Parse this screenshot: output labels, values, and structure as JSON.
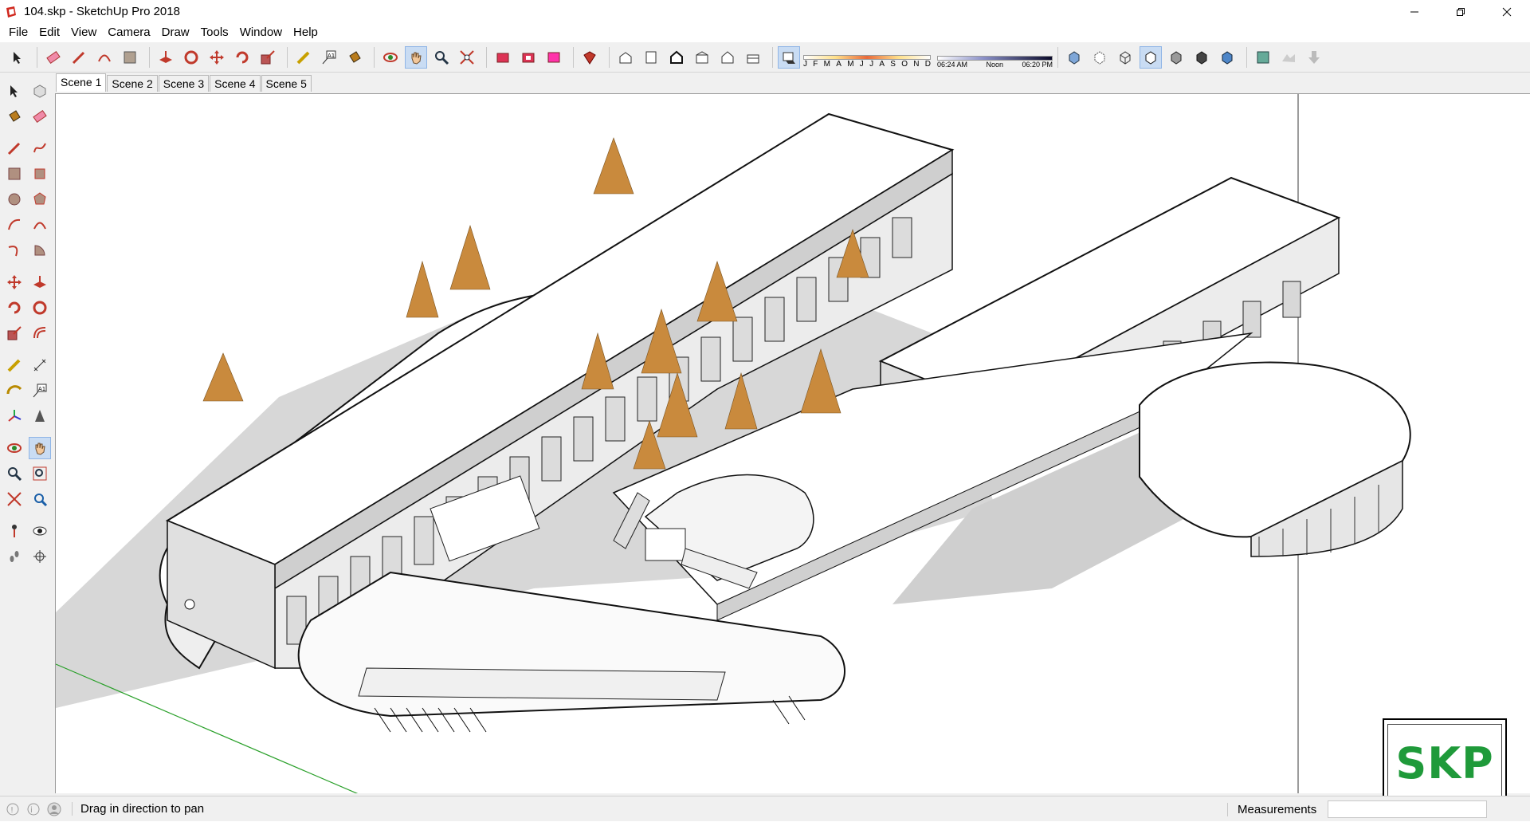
{
  "window": {
    "title": "104.skp - SketchUp Pro 2018",
    "app_icon": "sketchup-logo-icon",
    "controls": [
      "minimize-icon",
      "restore-icon",
      "close-icon"
    ]
  },
  "menu": [
    "File",
    "Edit",
    "View",
    "Camera",
    "Draw",
    "Tools",
    "Window",
    "Help"
  ],
  "toolbar": {
    "shadow_months": [
      "J",
      "F",
      "M",
      "A",
      "M",
      "J",
      "J",
      "A",
      "S",
      "O",
      "N",
      "D"
    ],
    "shadow_times": [
      "06:24 AM",
      "Noon",
      "06:20 PM"
    ]
  },
  "scenes": [
    "Scene 1",
    "Scene 2",
    "Scene 3",
    "Scene 4",
    "Scene 5"
  ],
  "active_scene": "Scene 1",
  "status": {
    "hint": "Drag in direction to pan",
    "measurements_label": "Measurements",
    "measurements_value": ""
  },
  "watermark": "SKP",
  "colors": {
    "accent_blue": "#c9dcf3",
    "green_axis": "#2aa02a",
    "tree": "#c98a3d",
    "shadow": "#a9a9a9",
    "logo_green": "#1f9a3a"
  }
}
